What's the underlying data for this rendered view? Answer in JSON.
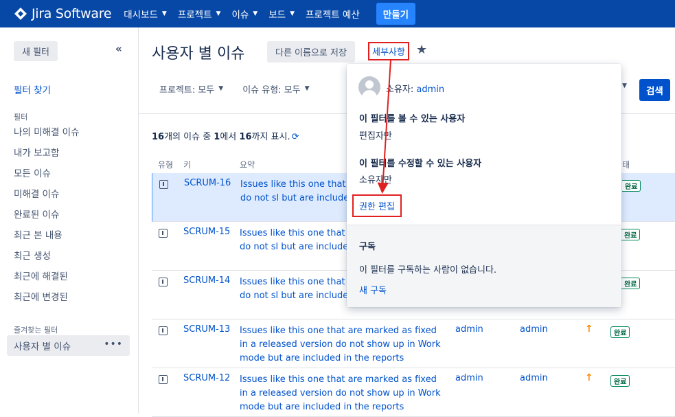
{
  "nav": {
    "brand": "Jira Software",
    "items": [
      "대시보드",
      "프로젝트",
      "이슈",
      "보드"
    ],
    "budget": "프로젝트 예산",
    "create": "만들기"
  },
  "sidebar": {
    "new_filter": "새 필터",
    "find_filters": "필터 찾기",
    "filters_title": "필터",
    "filters": [
      "나의 미해결 이슈",
      "내가 보고함",
      "모든 이슈",
      "미해결 이슈",
      "완료된 이슈",
      "최근 본 내용",
      "최근 생성",
      "최근에 해결된",
      "최근에 변경된"
    ],
    "favorites_title": "즐겨찾는 필터",
    "favorite": "사용자 별 이슈"
  },
  "header": {
    "title": "사용자 별 이슈",
    "save_as": "다른 이름으로 저장",
    "details": "세부사항",
    "filters": [
      "프로젝트: 모두",
      "이슈 유형: 모두"
    ],
    "search": "검색"
  },
  "results": {
    "count_start": "16",
    "count_mid1": "개의 이슈 중 ",
    "count_from": "1",
    "count_mid2": "에서 ",
    "count_to": "16",
    "count_end": "까지 표시."
  },
  "table": {
    "headers": [
      "유형",
      "키",
      "요약",
      "태"
    ],
    "rows": [
      {
        "key": "SCRUM-16",
        "summary": "Issues like this one that ar released version do not sl but are included in the re",
        "status": "완료"
      },
      {
        "key": "SCRUM-15",
        "summary": "Issues like this one that ar released version do not sl but are included in the re",
        "status": "완료"
      },
      {
        "key": "SCRUM-14",
        "summary": "Issues like this one that ar released version do not sl but are included in the reports",
        "status": "완료"
      },
      {
        "key": "SCRUM-13",
        "summary": "Issues like this one that are marked as fixed in a released version do not show up in Work mode but are included in the reports",
        "assignee": "admin",
        "reporter": "admin",
        "status": "완료"
      },
      {
        "key": "SCRUM-12",
        "summary": "Issues like this one that are marked as fixed in a released version do not show up in Work mode but are included in the reports",
        "assignee": "admin",
        "reporter": "admin",
        "status": "완료"
      }
    ]
  },
  "popover": {
    "owner_label": "소유자: ",
    "owner_name": "admin",
    "view_title": "이 필터를 볼 수 있는 사용자",
    "view_value": "편집자만",
    "edit_title": "이 필터를 수정할 수 있는 사용자",
    "edit_value": "소유자만",
    "edit_permissions": "권한 편집",
    "subscriptions_title": "구독",
    "no_subscribers": "이 필터를 구독하는 사람이 없습니다.",
    "new_subscription": "새 구독"
  },
  "colors": {
    "nav_bg": "#0747a6",
    "link": "#0052cc",
    "highlight_box": "#e0201f",
    "selected_row": "#deebff"
  }
}
